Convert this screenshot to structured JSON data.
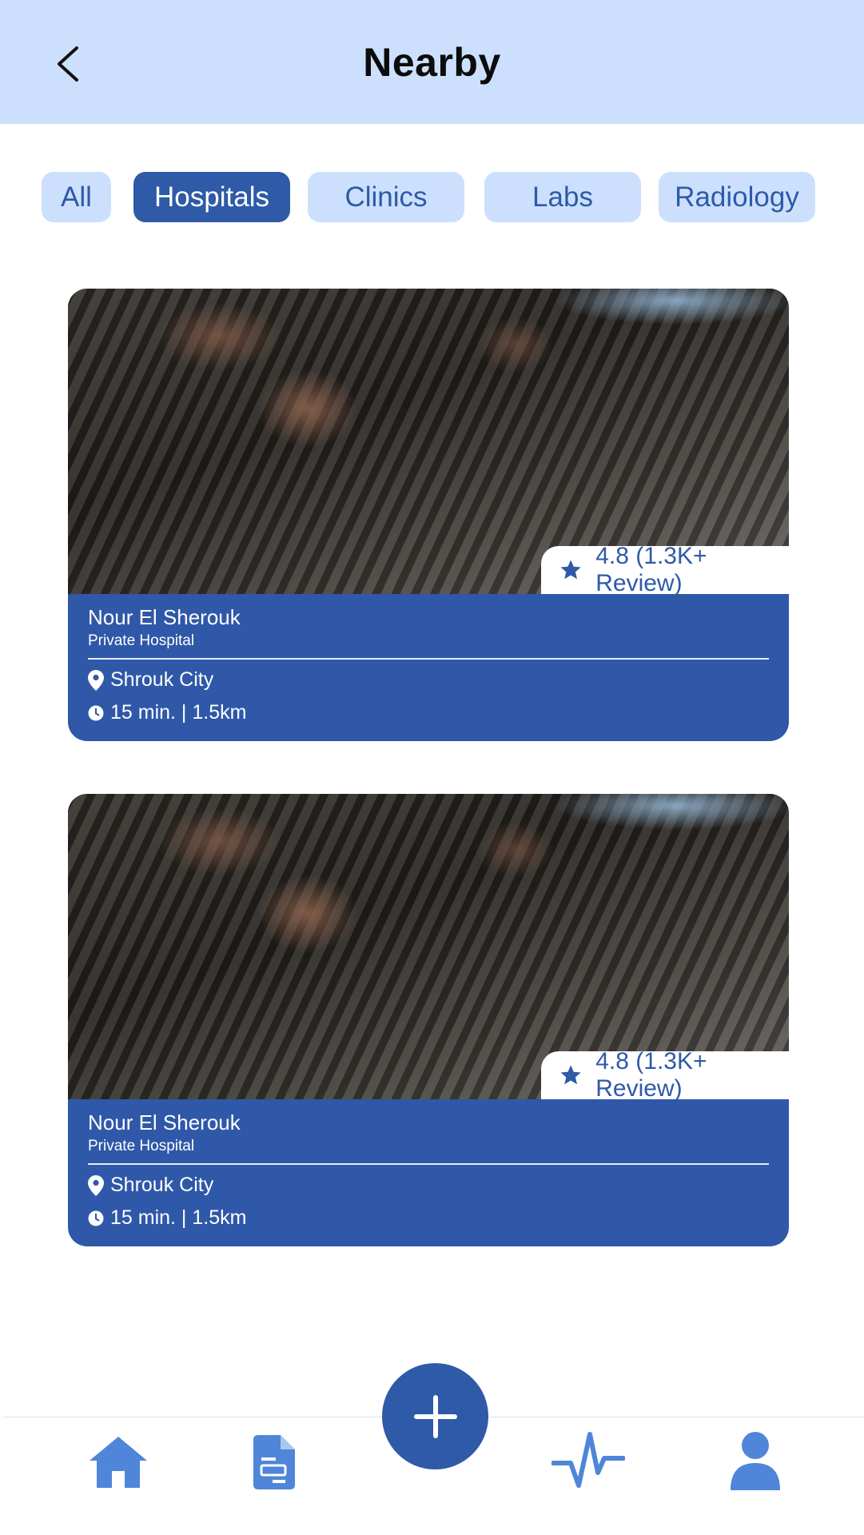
{
  "header": {
    "title": "Nearby",
    "back_icon": "chevron-left-icon"
  },
  "filters": [
    {
      "label": "All",
      "active": false
    },
    {
      "label": "Hospitals",
      "active": true
    },
    {
      "label": "Clinics",
      "active": false
    },
    {
      "label": "Labs",
      "active": false
    },
    {
      "label": "Radiology",
      "active": false
    }
  ],
  "cards": [
    {
      "image": "mixing-console-photo",
      "rating": "4.8 (1.3K+ Review)",
      "name": "Nour El Sherouk",
      "type": "Private Hospital",
      "location": "Shrouk City",
      "distance": "15 min. | 1.5km"
    },
    {
      "image": "mixing-console-photo",
      "rating": "4.8 (1.3K+ Review)",
      "name": "Nour El Sherouk",
      "type": "Private Hospital",
      "location": "Shrouk City",
      "distance": "15 min. | 1.5km"
    }
  ],
  "bottom_nav": {
    "items": [
      "home-icon",
      "document-icon",
      "add-icon",
      "activity-icon",
      "profile-icon"
    ]
  },
  "colors": {
    "primary": "#2e5aa8",
    "header_bg": "#cce0fd",
    "chip_bg": "#cce0fd",
    "nav_icon": "#4f86d9"
  }
}
